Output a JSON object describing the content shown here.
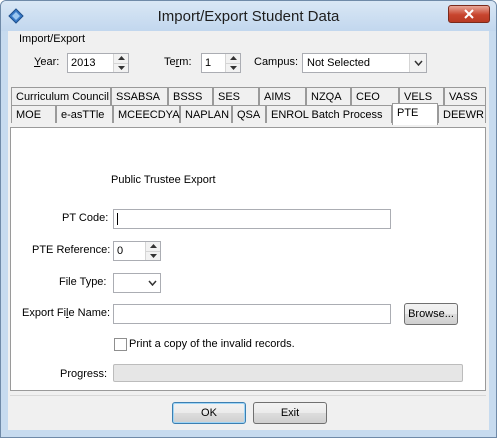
{
  "window": {
    "title": "Import/Export Student Data",
    "close_label": "X"
  },
  "group": {
    "label": "Import/Export",
    "year": {
      "label_prefix": "",
      "label_accel": "Y",
      "label_rest": "ear:",
      "value": "2013"
    },
    "term": {
      "label_prefix": "Te",
      "label_accel": "r",
      "label_rest": "m:",
      "value": "1"
    },
    "campus": {
      "label": "Campus:",
      "value": "Not Selected"
    }
  },
  "tabs_row1": [
    {
      "label": "Curriculum Council"
    },
    {
      "label": "SSABSA"
    },
    {
      "label": "BSSS"
    },
    {
      "label": "SES"
    },
    {
      "label": "AIMS"
    },
    {
      "label": "NZQA"
    },
    {
      "label": "CEO"
    },
    {
      "label": "VELS"
    },
    {
      "label": "VASS"
    }
  ],
  "tabs_row2": [
    {
      "label": "MOE"
    },
    {
      "label": "e-asTTle"
    },
    {
      "label": "MCEECDYA"
    },
    {
      "label": "NAPLAN"
    },
    {
      "label": "QSA"
    },
    {
      "label": "ENROL Batch Process"
    },
    {
      "label": "PTE"
    },
    {
      "label": "DEEWR"
    }
  ],
  "active_tab": "PTE",
  "pte": {
    "heading": "Public Trustee Export",
    "pt_code": {
      "label": "PT Code:",
      "value": ""
    },
    "pte_reference": {
      "label": "PTE Reference:",
      "value": "0"
    },
    "file_type": {
      "label": "File Type:",
      "value": ""
    },
    "export_file_name": {
      "label_prefix": "Export Fi",
      "label_accel": "l",
      "label_rest": "e Name:",
      "value": ""
    },
    "browse_label": "Browse...",
    "print_invalid": {
      "label": "Print a copy of the invalid records.",
      "checked": false
    },
    "progress": {
      "label": "Progress:",
      "percent": 0
    }
  },
  "buttons": {
    "ok": "OK",
    "exit": "Exit"
  },
  "colors": {
    "title_bar": "#c7dbef",
    "close_button": "#c8452e",
    "progress_fill": "#06b025"
  }
}
